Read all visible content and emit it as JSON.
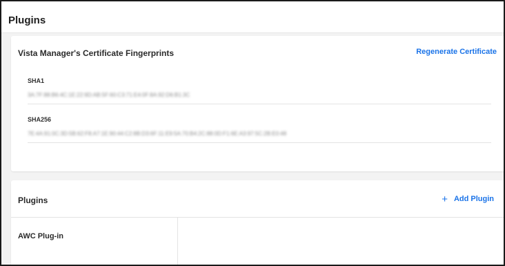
{
  "header": {
    "title": "Plugins"
  },
  "certificate": {
    "title": "Vista Manager's Certificate Fingerprints",
    "regenerate_label": "Regenerate Certificate",
    "fingerprints": [
      {
        "label": "SHA1",
        "value": "3A:7F:88:B6:4C:1E:22:9D:AB:5F:60:C3:71:E4:0F:8A:92:D6:B1:3C"
      },
      {
        "label": "SHA256",
        "value": "7E:4A:91:0C:3D:5B:62:F8:A7:1E:90:44:C2:8B:D3:6F:11:E9:5A:70:B4:2C:88:0D:F1:6E:A3:97:5C:2B:E0:48"
      }
    ]
  },
  "plugins": {
    "title": "Plugins",
    "add_label": "Add Plugin",
    "add_icon": "plus-icon",
    "items": [
      {
        "label": "AWC Plug-in"
      }
    ]
  },
  "colors": {
    "accent": "#1a73e8",
    "background": "#f3f3f3",
    "card": "#ffffff",
    "divider": "#e3e3e3"
  }
}
